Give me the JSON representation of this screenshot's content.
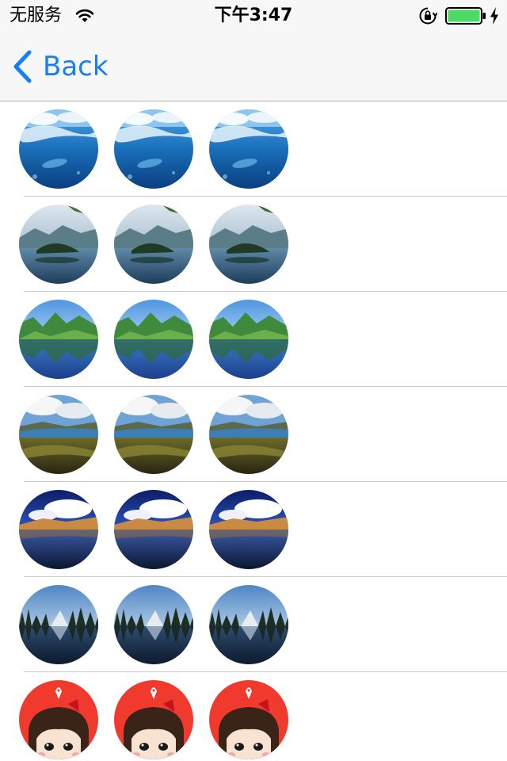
{
  "status_bar": {
    "carrier": "无服务",
    "time": "下午3:47",
    "icons": [
      "wifi-icon",
      "rotation-lock-icon",
      "battery-icon",
      "charging-bolt-icon"
    ],
    "battery_color": "#4cd964"
  },
  "nav": {
    "back_label": "Back",
    "accent_color": "#157efb"
  },
  "rows": [
    {
      "image": "ocean-dolphin-image",
      "count": 3
    },
    {
      "image": "lake-island-image",
      "count": 3
    },
    {
      "image": "mountain-lake-reflection-image",
      "count": 3
    },
    {
      "image": "river-valley-hills-image",
      "count": 3
    },
    {
      "image": "desert-lake-clouds-image",
      "count": 3
    },
    {
      "image": "forest-lake-reflection-image",
      "count": 3
    },
    {
      "image": "cartoon-girl-image",
      "count": 3
    }
  ]
}
